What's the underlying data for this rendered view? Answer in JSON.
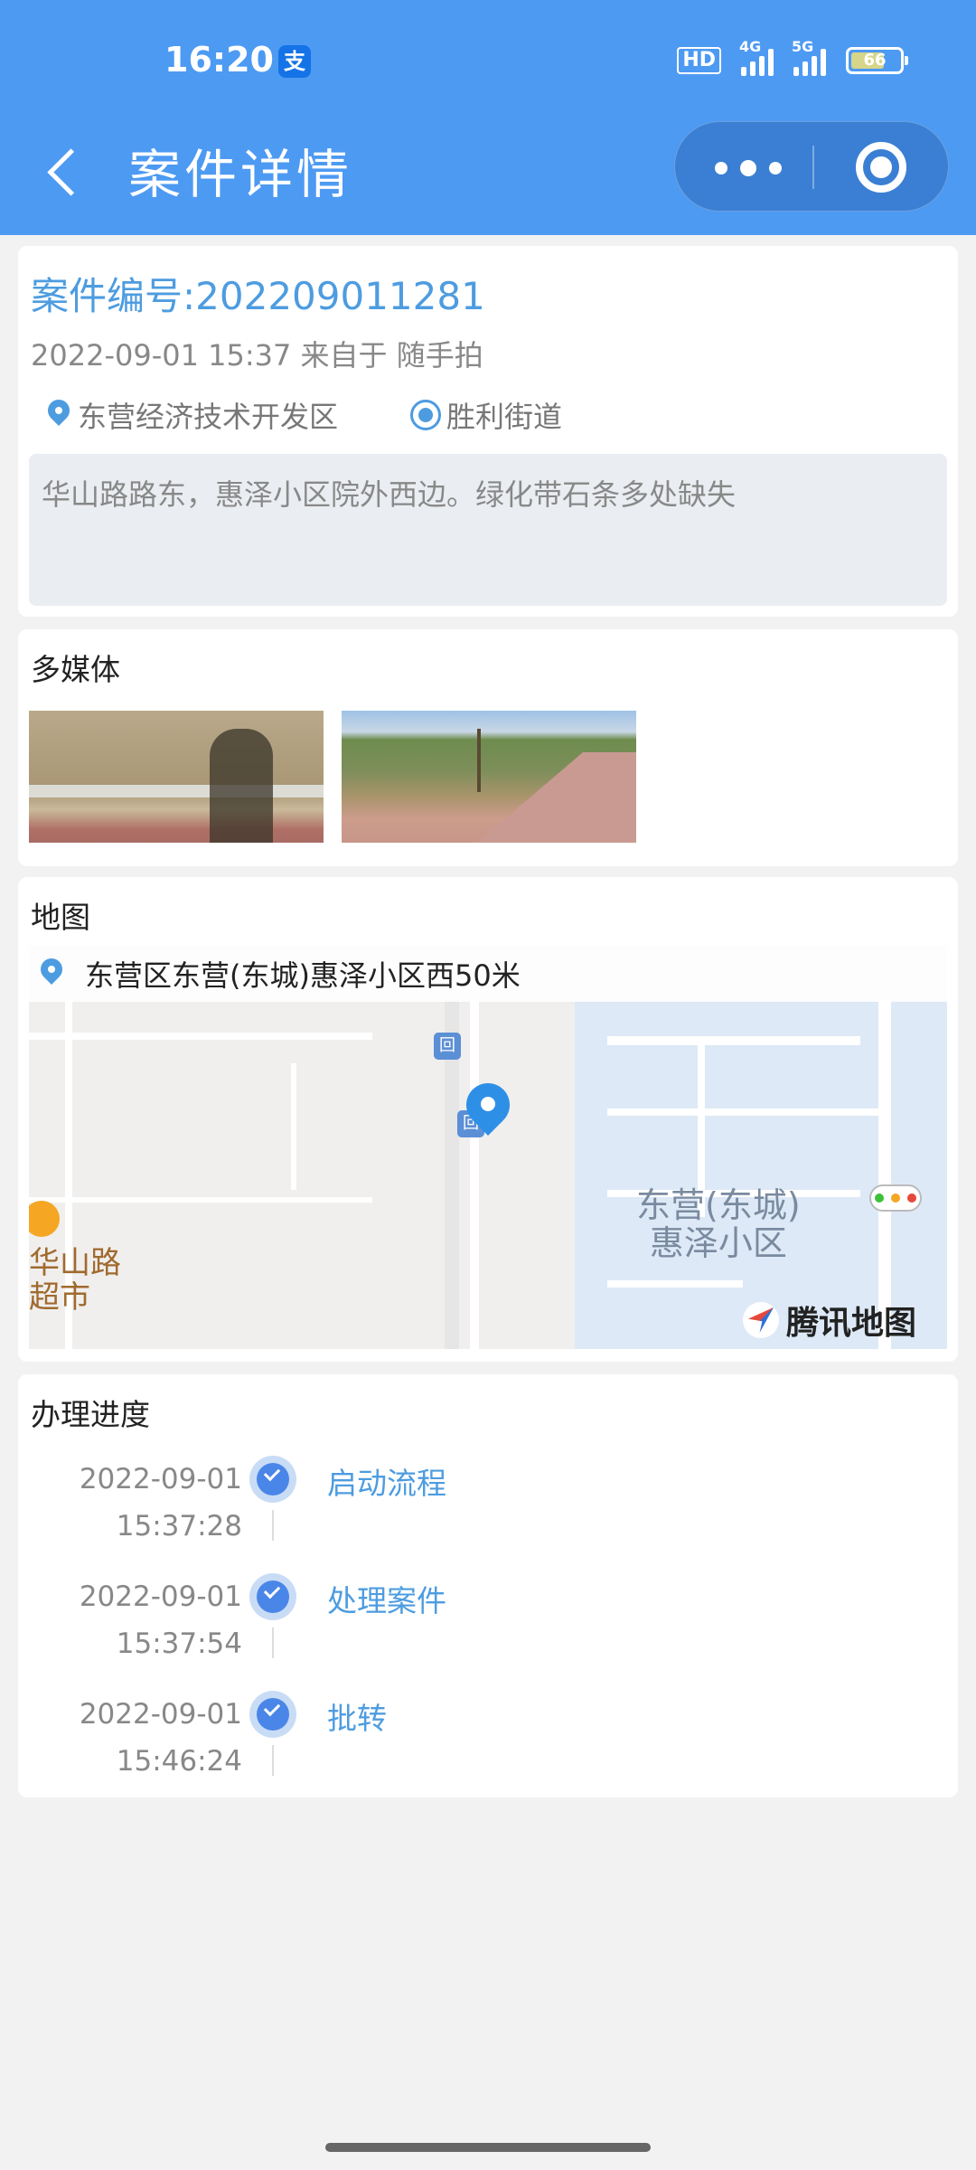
{
  "status": {
    "time": "16:20",
    "alipay_glyph": "支",
    "hd": "HD",
    "net1": "4G",
    "net2": "5G",
    "battery": "66"
  },
  "nav": {
    "title": "案件详情"
  },
  "case": {
    "number": "案件编号:202209011281",
    "meta": "2022-09-01 15:37 来自于 随手拍",
    "district": "东营经济技术开发区",
    "street": "胜利街道",
    "description": "华山路路东，惠泽小区院外西边。绿化带石条多处缺失"
  },
  "media": {
    "title": "多媒体"
  },
  "map": {
    "title": "地图",
    "address": "东营区东营(东城)惠泽小区西50米",
    "area_label_1": "东营(东城)",
    "area_label_2": "惠泽小区",
    "poi_1": "华山路",
    "poi_2": "超市",
    "bus_glyph": "回",
    "logo": "腾讯地图"
  },
  "progress": {
    "title": "办理进度",
    "steps": [
      {
        "date": "2022-09-01",
        "time": "15:37:28",
        "label": "启动流程"
      },
      {
        "date": "2022-09-01",
        "time": "15:37:54",
        "label": "处理案件"
      },
      {
        "date": "2022-09-01",
        "time": "15:46:24",
        "label": "批转"
      }
    ]
  },
  "colors": {
    "brand": "#4d9af3",
    "link": "#4d9ce0"
  }
}
